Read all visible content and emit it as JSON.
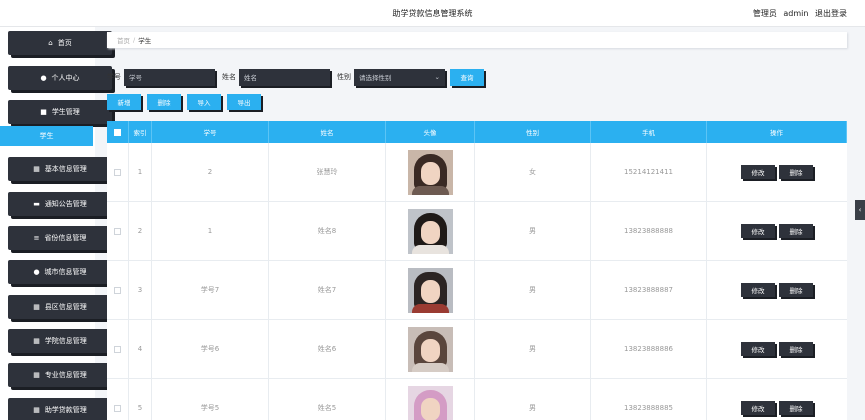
{
  "header": {
    "title": "助学贷款信息管理系统",
    "role": "管理员",
    "user": "admin",
    "logout": "退出登录"
  },
  "sidebar": {
    "items": [
      {
        "label": "首页",
        "icon": "home-icon",
        "glyph": "⌂"
      },
      {
        "label": "个人中心",
        "icon": "user-icon",
        "glyph": "●"
      },
      {
        "label": "学生管理",
        "icon": "briefcase-icon",
        "glyph": "■"
      },
      {
        "label": "基本信息管理",
        "icon": "grid-icon",
        "glyph": "▦"
      },
      {
        "label": "通知公告管理",
        "icon": "message-icon",
        "glyph": "▬"
      },
      {
        "label": "省份信息管理",
        "icon": "list-icon",
        "glyph": "≡"
      },
      {
        "label": "城市信息管理",
        "icon": "user-icon",
        "glyph": "●"
      },
      {
        "label": "县区信息管理",
        "icon": "grid-icon",
        "glyph": "▦"
      },
      {
        "label": "学院信息管理",
        "icon": "grid-icon",
        "glyph": "▦"
      },
      {
        "label": "专业信息管理",
        "icon": "grid-icon",
        "glyph": "▦"
      },
      {
        "label": "助学贷款管理",
        "icon": "grid-icon",
        "glyph": "▦"
      }
    ],
    "active_sub": "学生"
  },
  "breadcrumb": {
    "root": "首页",
    "current": "学生"
  },
  "search": {
    "id_label": "学号",
    "id_placeholder": "学号",
    "name_label": "姓名",
    "name_placeholder": "姓名",
    "gender_label": "性别",
    "gender_placeholder": "请选择性别",
    "query_button": "查询"
  },
  "actions": {
    "add": "新增",
    "delete": "删除",
    "import": "导入",
    "export": "导出"
  },
  "table": {
    "columns": [
      "索引",
      "学号",
      "姓名",
      "头像",
      "性别",
      "手机",
      "操作"
    ],
    "rows": [
      {
        "index": "1",
        "student_id": "2",
        "name": "张慧玲",
        "gender": "女",
        "phone": "15214121411"
      },
      {
        "index": "2",
        "student_id": "1",
        "name": "姓名8",
        "gender": "男",
        "phone": "13823888888"
      },
      {
        "index": "3",
        "student_id": "学号7",
        "name": "姓名7",
        "gender": "男",
        "phone": "13823888887"
      },
      {
        "index": "4",
        "student_id": "学号6",
        "name": "姓名6",
        "gender": "男",
        "phone": "13823888886"
      },
      {
        "index": "5",
        "student_id": "学号5",
        "name": "姓名5",
        "gender": "男",
        "phone": "13823888885"
      }
    ],
    "edit_label": "修改",
    "delete_label": "删除"
  },
  "edge_handle": "‹"
}
